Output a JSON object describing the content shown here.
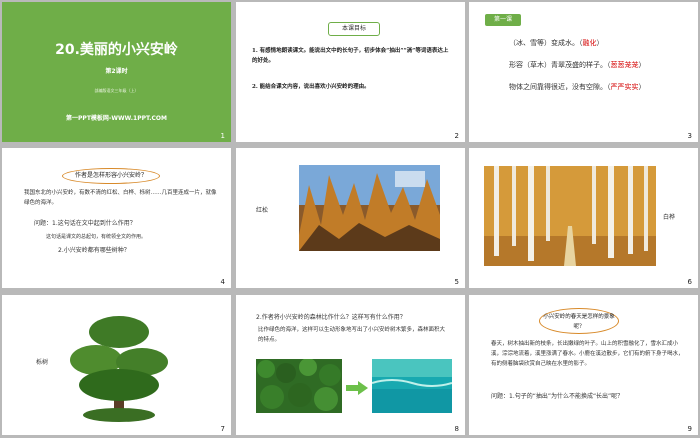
{
  "slides": [
    {
      "num": "1",
      "title": "20.美丽的小兴安岭",
      "subtitle": "第2课时",
      "edition": "部编版语文三年级（上）",
      "footer": "第一PPT模板网-WWW.1PPT.COM"
    },
    {
      "num": "2",
      "box": "本课目标",
      "goal1": "1. 有感情地朗读课文。能说出文中的长句子，初步体会“抽出”“淌”等词语表达上的好处。",
      "goal2": "2. 能结合课文内容，说出喜欢小兴安岭的理由。"
    },
    {
      "num": "3",
      "tag": "第一课",
      "l1a": "（冰、雪等）变成水。（",
      "l1b": "融化",
      "l1c": "）",
      "l2a": "形容（草木）青翠茂盛的样子。（",
      "l2b": "葱葱茏茏",
      "l2c": "）",
      "l3a": "物体之间靠得很近，没有空隙。（",
      "l3b": "严严实实",
      "l3c": "）"
    },
    {
      "num": "4",
      "bubble": "作者是怎样形容小兴安岭？",
      "para": "我国东北的小兴安岭，有数不清的红松、白桦、栎树……几百里连成一片，就像绿色的海洋。",
      "q1": "问题：1.这句话在文中起到什么作用？",
      "a1": "这句话是课文的总起句，有统领全文的作用。",
      "q2": "2.小兴安岭都有哪些树种？"
    },
    {
      "num": "5",
      "label": "红松"
    },
    {
      "num": "6",
      "label": "白桦"
    },
    {
      "num": "7",
      "label": "栎树"
    },
    {
      "num": "8",
      "q": "2.作者将小兴安岭的森林比作什么？这样写有什么作用？",
      "para": "比作绿色的海洋，这样可以生动形象地写出了小兴安岭树木繁多，森林面积大的特点。"
    },
    {
      "num": "9",
      "bubble": "小兴安岭的春天是怎样的景象呢？",
      "para": "春天，树木抽出新的枝条，长出嫩绿的叶子。山上的积雪融化了，雪水汇成小溪，淙淙地流着，溪里涨满了春水。小鹿在溪边散步，它们有的俯下身子喝水，有的侧着脑袋欣赏自己映在水里的影子。",
      "q": "问题：1.句子的“抽出”为什么不能换成“长出”呢？"
    }
  ]
}
